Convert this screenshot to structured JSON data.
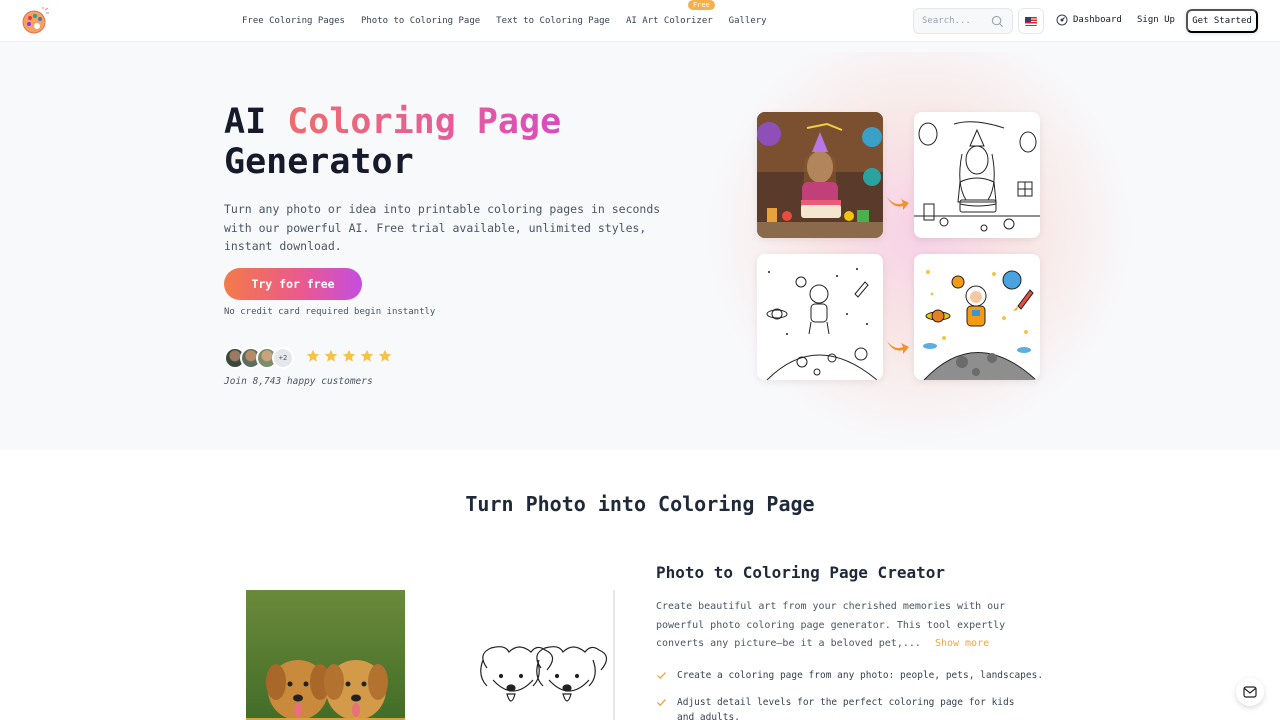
{
  "nav": {
    "links": [
      "Free Coloring Pages",
      "Photo to Coloring Page",
      "Text to Coloring Page",
      "AI Art Colorizer",
      "Gallery"
    ],
    "badge": "Free",
    "search_placeholder": "Search...",
    "dashboard": "Dashboard",
    "sign_up": "Sign Up",
    "get_started": "Get Started"
  },
  "hero": {
    "title_prefix": "AI ",
    "title_gradient": "Coloring Page",
    "title_suffix": "Generator",
    "description": "Turn any photo or idea into printable coloring pages in seconds with our powerful AI. Free trial available, unlimited styles, instant download.",
    "cta": "Try for free",
    "cta_note": "No credit card required begin instantly",
    "avatar_more": "+2",
    "rating_stars": 5,
    "social_proof": "Join 8,743 happy customers",
    "tiles": [
      "birthday-photo",
      "birthday-line-art",
      "astronaut-line-art",
      "astronaut-colored"
    ]
  },
  "section": {
    "title": "Turn Photo into Coloring Page",
    "creator_title": "Photo to Coloring Page Creator",
    "creator_desc": "Create beautiful art from your cherished memories with our powerful photo coloring page generator. This tool expertly converts any picture—be it a beloved pet,...",
    "show_more": "Show more",
    "features": [
      "Create a coloring page from any photo: people, pets, landscapes.",
      "Adjust detail levels for the perfect coloring page for kids and adults."
    ]
  },
  "colors": {
    "accent_orange": "#f0a542",
    "gradient_start": "#f37a4a",
    "gradient_end": "#c54de0"
  }
}
